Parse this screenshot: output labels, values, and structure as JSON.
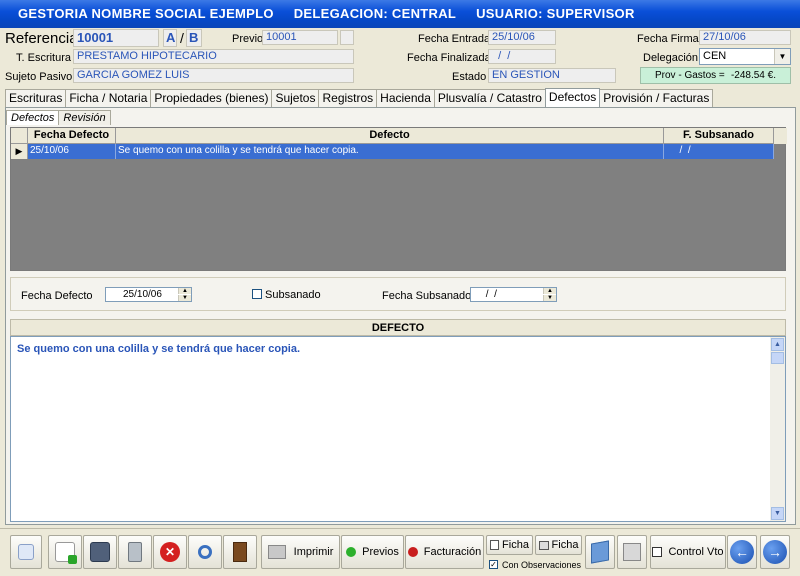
{
  "window": {
    "app_name": "GESTORIA NOMBRE SOCIAL EJEMPLO",
    "delegacion": "DELEGACION:  CENTRAL",
    "usuario": "USUARIO:  SUPERVISOR"
  },
  "header": {
    "referencia_label": "Referencia",
    "referencia_value": "10001",
    "a_label": "A",
    "slash": "/",
    "b_label": "B",
    "previo_label": "Previo",
    "previo_value": "10001",
    "fecha_entrada_label": "Fecha Entrada",
    "fecha_entrada_value": "25/10/06",
    "fecha_firma_label": "Fecha Firma",
    "fecha_firma_value": "27/10/06",
    "t_escritura_label": "T. Escritura",
    "t_escritura_value": "PRESTAMO HIPOTECARIO",
    "fecha_finalizada_label": "Fecha Finalizada",
    "fecha_finalizada_value": "  /  /",
    "delegacion_label": "Delegación",
    "delegacion_value": "CEN",
    "sujeto_pasivo_label": "Sujeto Pasivo",
    "sujeto_pasivo_value": "GARCIA GOMEZ LUIS",
    "estado_label": "Estado",
    "estado_value": "EN GESTION",
    "prov_gastos_label": "Prov - Gastos =",
    "prov_gastos_value": "-248.54 €."
  },
  "tabs": [
    {
      "label": "Escrituras"
    },
    {
      "label": "Ficha / Notaria"
    },
    {
      "label": "Propiedades (bienes)"
    },
    {
      "label": "Sujetos"
    },
    {
      "label": "Registros"
    },
    {
      "label": "Hacienda"
    },
    {
      "label": "Plusvalía / Catastro"
    },
    {
      "label": "Defectos",
      "active": true
    },
    {
      "label": "Provisión / Facturas"
    }
  ],
  "subtabs": [
    {
      "label": "Defectos",
      "active": true
    },
    {
      "label": "Revisión"
    }
  ],
  "grid": {
    "columns": [
      "Fecha Defecto",
      "Defecto",
      "F. Subsanado"
    ],
    "rows": [
      {
        "indicator": "▶",
        "fecha": "25/10/06",
        "defecto": "Se quemo con una colilla y se tendrá que hacer copia.",
        "subsanado": "  /  /"
      }
    ]
  },
  "filter": {
    "fecha_defecto_label": "Fecha Defecto",
    "fecha_defecto_value": "25/10/06",
    "subsanado_label": "Subsanado",
    "fecha_subsanado_label": "Fecha Subsanado",
    "fecha_subsanado_value": " /  /"
  },
  "memo": {
    "header": "DEFECTO",
    "text": "Se quemo con una colilla y se tendrá que hacer copia."
  },
  "toolbar": {
    "imprimir": "Imprimir",
    "previos": "Previos",
    "facturacion": "Facturación",
    "ficha1": "Ficha",
    "ficha2": "Ficha",
    "con_observaciones": "Con Observaciones",
    "control_vto": "Control Vto"
  },
  "colors": {
    "title_bar": "#0a4fd8",
    "field_text": "#2a55b8",
    "selected_row": "#3a6ed2",
    "grid_bg": "#808080"
  }
}
